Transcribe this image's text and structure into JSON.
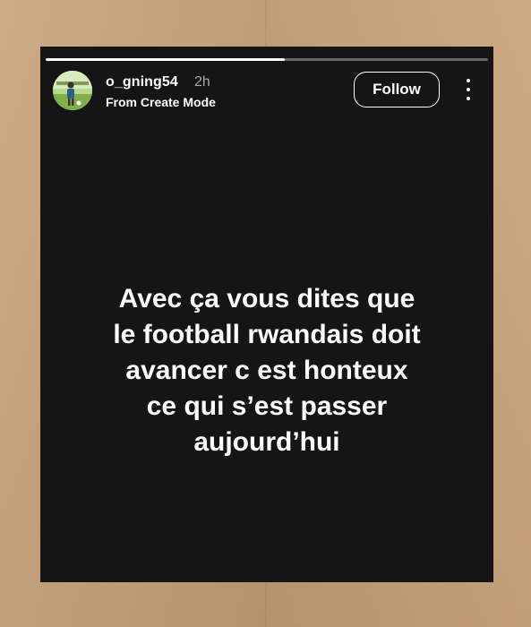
{
  "story": {
    "progress": 0.54,
    "header": {
      "username": "o_gning54",
      "timestamp": "2h",
      "subtitle": "From Create Mode",
      "follow_label": "Follow",
      "avatar_icon": "profile-photo-football-pitch",
      "more_icon": "more-vertical-icon"
    },
    "text": "Avec ça vous dites que\nle football rwandais doit\navancer c est honteux\nce qui s’est passer\naujourd’hui",
    "colors": {
      "background": "#151515",
      "text": "#ffffff",
      "timestamp": "#a8a8a8",
      "paper": "#c8a078"
    }
  }
}
